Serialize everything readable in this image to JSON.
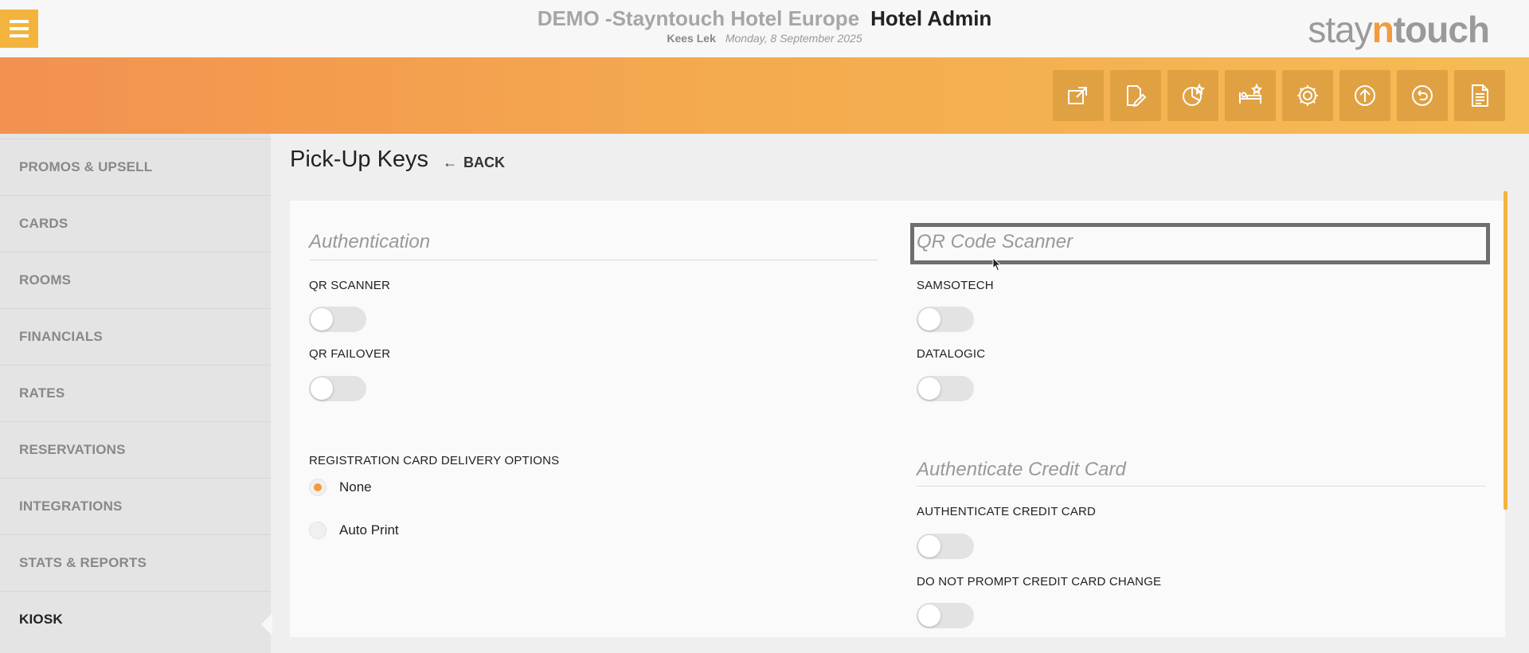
{
  "header": {
    "hotel_name": "DEMO -Stayntouch Hotel Europe",
    "app_title": "Hotel Admin",
    "user": "Kees Lek",
    "date": "Monday, 8 September 2025",
    "logo_stay": "stay",
    "logo_n": "n",
    "logo_touch": "touch"
  },
  "toolbar_icons": [
    "external-link-icon",
    "edit-document-icon",
    "chart-star-icon",
    "bed-star-icon",
    "gear-icon",
    "upload-circle-icon",
    "undo-circle-icon",
    "document-list-icon"
  ],
  "sidebar": {
    "items": [
      {
        "label": "PROMOS & UPSELL"
      },
      {
        "label": "CARDS"
      },
      {
        "label": "ROOMS"
      },
      {
        "label": "FINANCIALS"
      },
      {
        "label": "RATES"
      },
      {
        "label": "RESERVATIONS"
      },
      {
        "label": "INTEGRATIONS"
      },
      {
        "label": "STATS & REPORTS"
      },
      {
        "label": "KIOSK"
      }
    ],
    "active": "KIOSK"
  },
  "page": {
    "title": "Pick-Up Keys",
    "back_label": "BACK"
  },
  "left": {
    "section_title": "Authentication",
    "qr_scanner": {
      "label": "QR SCANNER",
      "on": false
    },
    "qr_failover": {
      "label": "QR FAILOVER",
      "on": false
    },
    "delivery": {
      "label": "REGISTRATION CARD DELIVERY OPTIONS",
      "options": [
        {
          "label": "None",
          "selected": true
        },
        {
          "label": "Auto Print",
          "selected": false
        }
      ]
    }
  },
  "right": {
    "section_title": "QR Code Scanner",
    "samsotech": {
      "label": "SAMSOTECH",
      "on": false
    },
    "datalogic": {
      "label": "DATALOGIC",
      "on": false
    },
    "cc_section_title": "Authenticate Credit Card",
    "authenticate_cc": {
      "label": "AUTHENTICATE CREDIT CARD",
      "on": false
    },
    "no_prompt_cc": {
      "label": "DO NOT PROMPT CREDIT CARD CHANGE",
      "on": false
    }
  },
  "colors": {
    "accent": "#f29b3d",
    "banner_start": "#f29150",
    "banner_end": "#f5bc55",
    "icon_button": "#e0a142"
  }
}
